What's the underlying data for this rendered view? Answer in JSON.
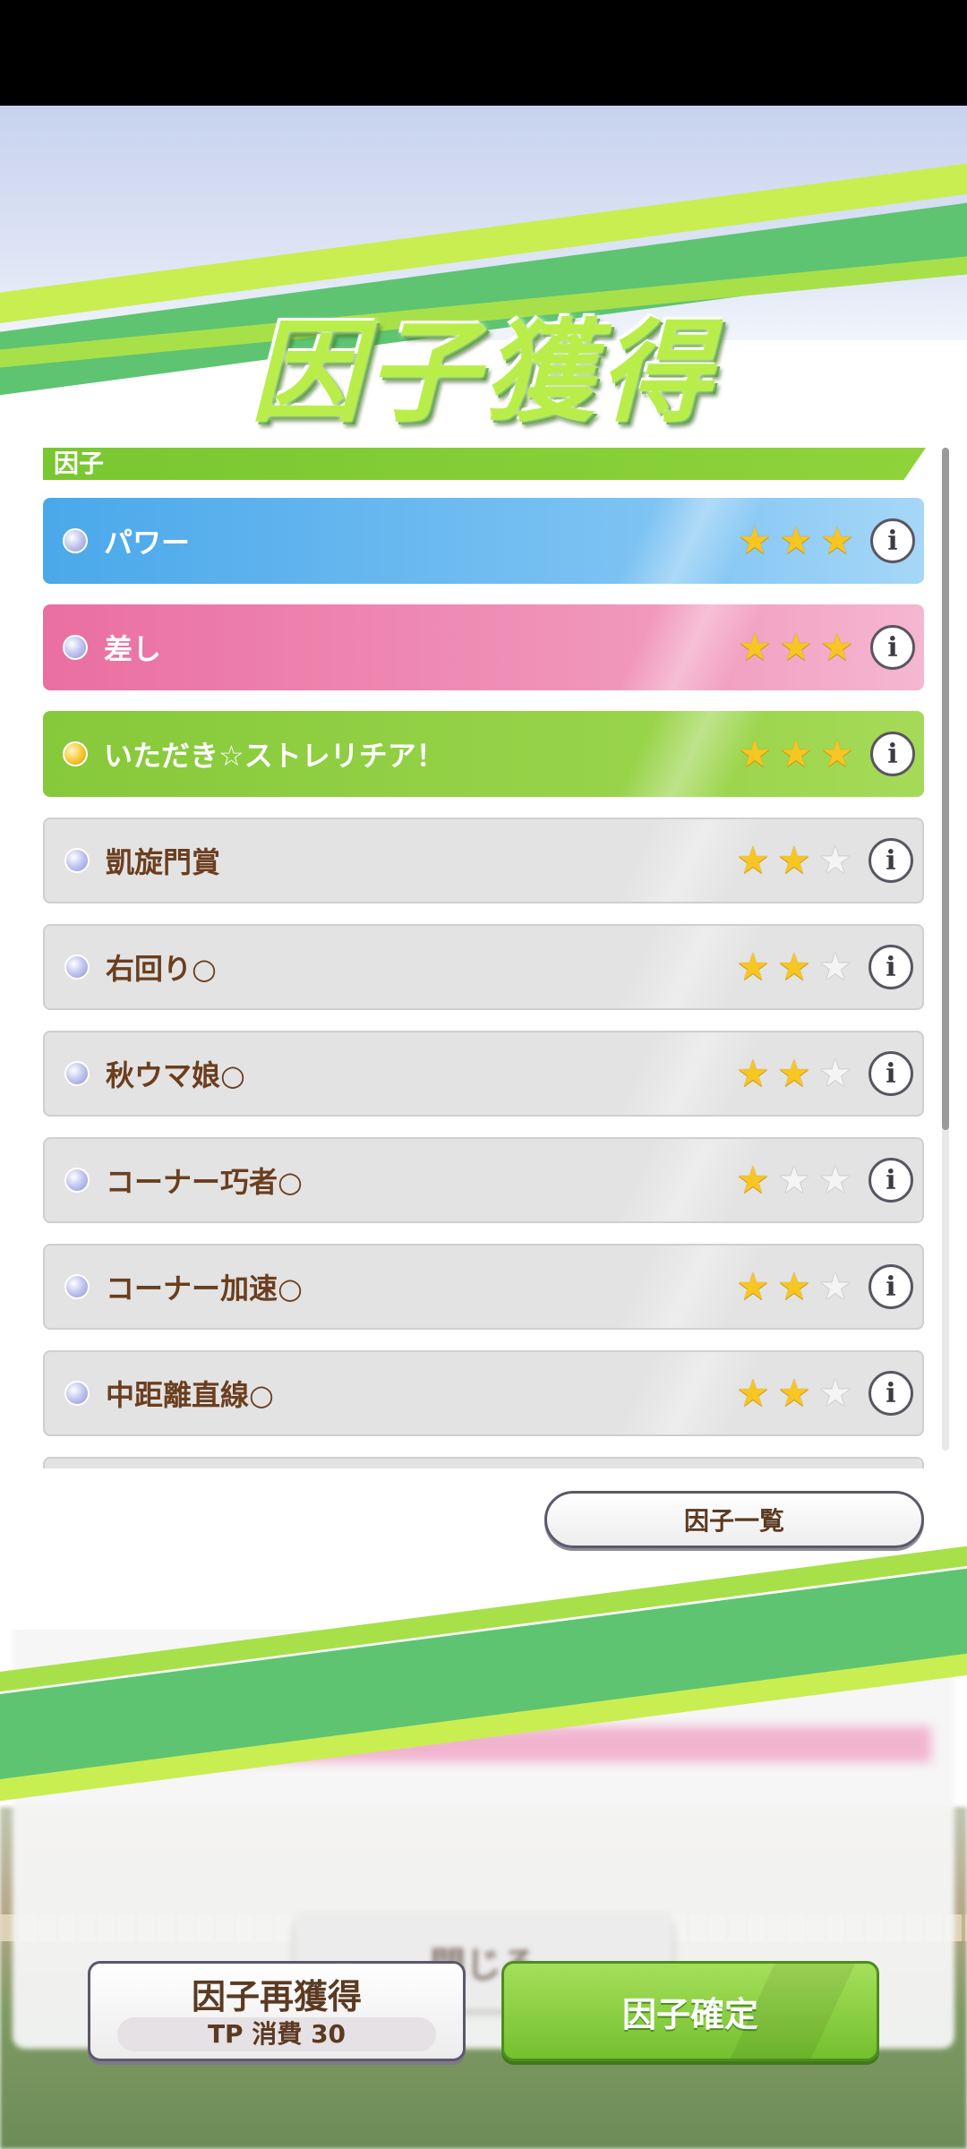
{
  "title": "因子獲得",
  "section_header": "因子",
  "factors": [
    {
      "label": "パワー",
      "stars": 3,
      "color": "blue",
      "info_label": "i"
    },
    {
      "label": "差し",
      "stars": 3,
      "color": "pink",
      "info_label": "i"
    },
    {
      "label": "いただき☆ストレリチア！",
      "stars": 3,
      "color": "green",
      "info_label": "i"
    },
    {
      "label": "凱旋門賞",
      "stars": 2,
      "color": "gray",
      "info_label": "i"
    },
    {
      "label": "右回り○",
      "stars": 2,
      "color": "gray",
      "info_label": "i"
    },
    {
      "label": "秋ウマ娘○",
      "stars": 2,
      "color": "gray",
      "info_label": "i"
    },
    {
      "label": "コーナー巧者○",
      "stars": 1,
      "color": "gray",
      "info_label": "i"
    },
    {
      "label": "コーナー加速○",
      "stars": 2,
      "color": "gray",
      "info_label": "i"
    },
    {
      "label": "中距離直線○",
      "stars": 2,
      "color": "gray",
      "info_label": "i"
    }
  ],
  "factor_list_button": "因子一覧",
  "background_close_button": "閉じる",
  "reacquire_button": {
    "label": "因子再獲得",
    "cost": "TP 消費 30"
  },
  "confirm_button": "因子確定",
  "colors": {
    "blue": "#4aa8ea",
    "pink": "#ea6fa0",
    "green": "#86c93a",
    "gray": "#e3e3e3",
    "accent_green": "#79c731"
  }
}
